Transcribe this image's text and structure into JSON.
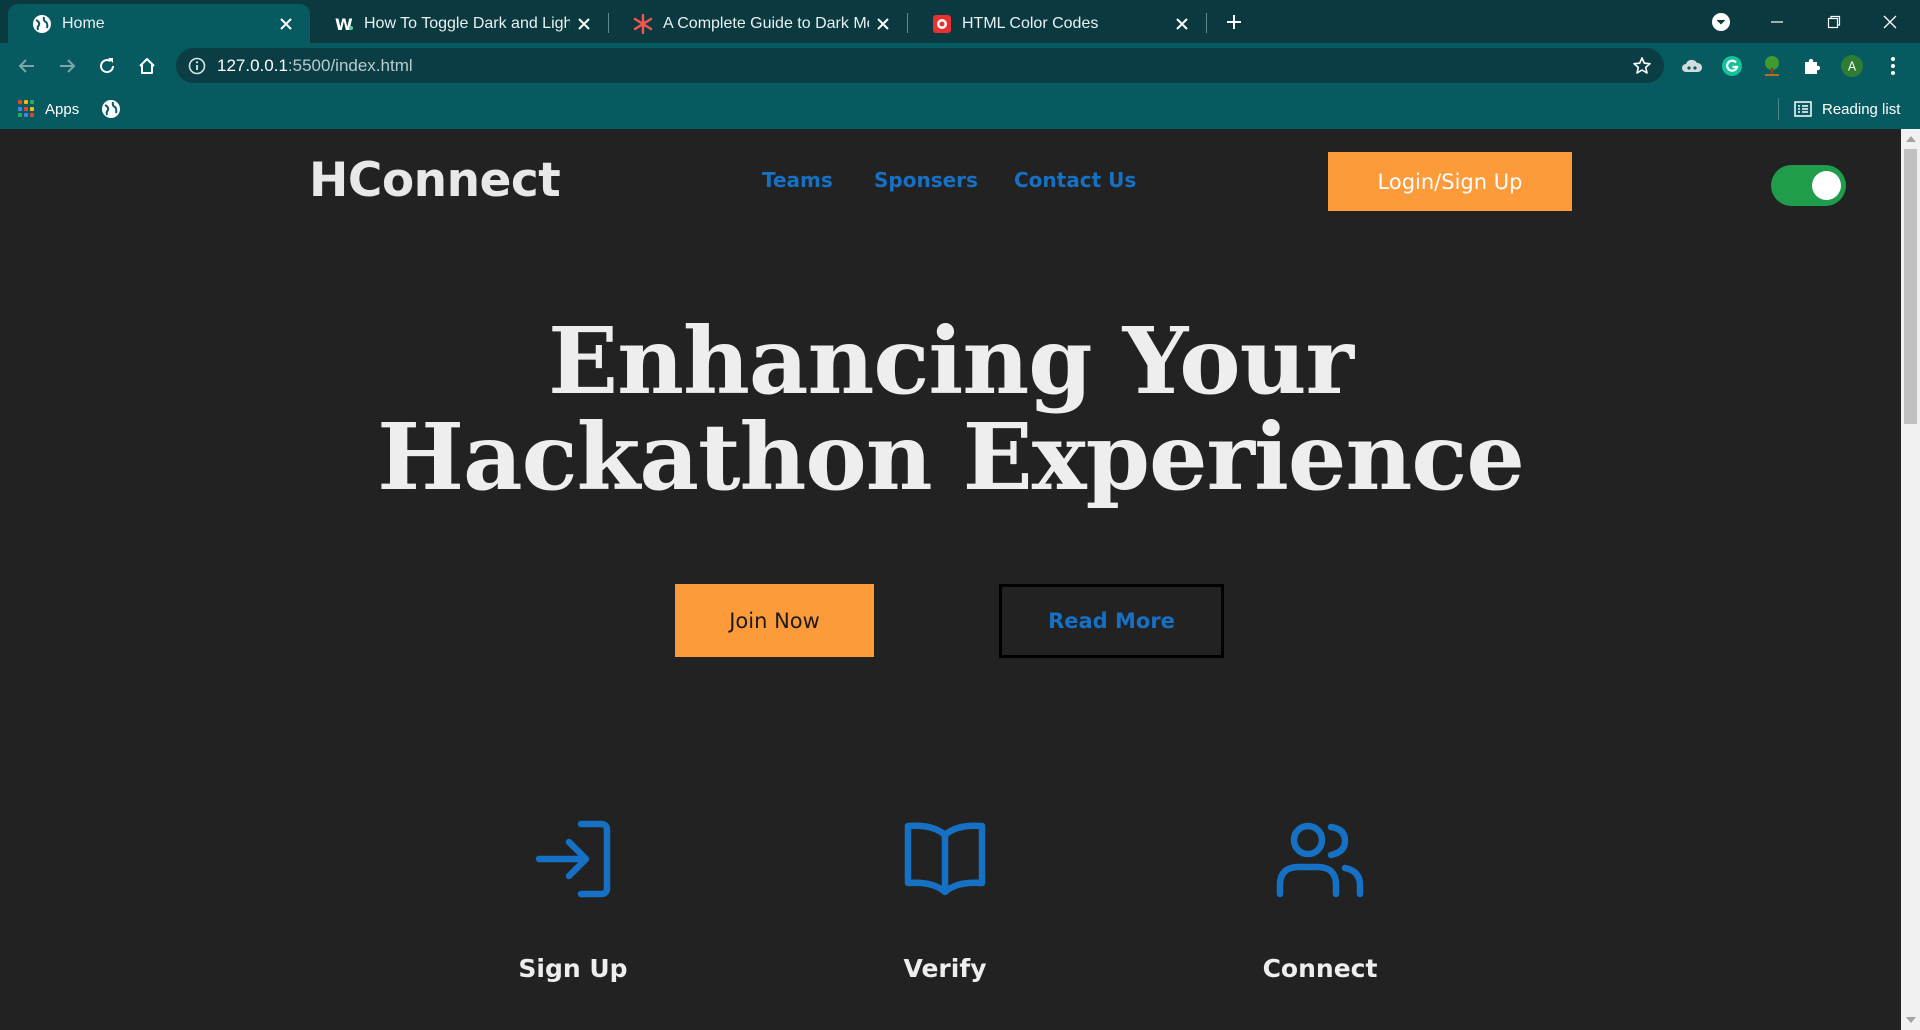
{
  "browser": {
    "tabs": [
      {
        "title": "Home",
        "favicon": "globe-icon",
        "active": true
      },
      {
        "title": "How To Toggle Dark and Light Mo",
        "favicon": "w-letter-icon",
        "active": false
      },
      {
        "title": "A Complete Guide to Dark Mode",
        "favicon": "asterisk-icon",
        "active": false
      },
      {
        "title": "HTML Color Codes",
        "favicon": "color-codes-icon",
        "active": false
      }
    ],
    "url_host": "127.0.0.1",
    "url_path": ":5500/index.html",
    "profile_initial": "A",
    "bookmarks": {
      "apps_label": "Apps",
      "reading_list_label": "Reading list"
    },
    "colors": {
      "tabbar": "#0b3940",
      "toolbar": "#075a60",
      "omnibox": "#0a3e44"
    }
  },
  "page": {
    "logo": "HConnect",
    "nav": {
      "teams": "Teams",
      "sponsers": "Sponsers",
      "contact": "Contact Us"
    },
    "login_label": "Login/Sign Up",
    "theme_toggle_on": true,
    "hero": {
      "line1": "Enhancing Your",
      "line2": "Hackathon Experience"
    },
    "join_label": "Join Now",
    "read_more_label": "Read More",
    "features": {
      "signup": "Sign Up",
      "verify": "Verify",
      "connect": "Connect"
    },
    "colors": {
      "background": "#222222",
      "accent_orange": "#fd9a3a",
      "link_blue": "#1670c4",
      "toggle_green": "#1f9d4a",
      "text_light": "#eeeeee"
    }
  }
}
